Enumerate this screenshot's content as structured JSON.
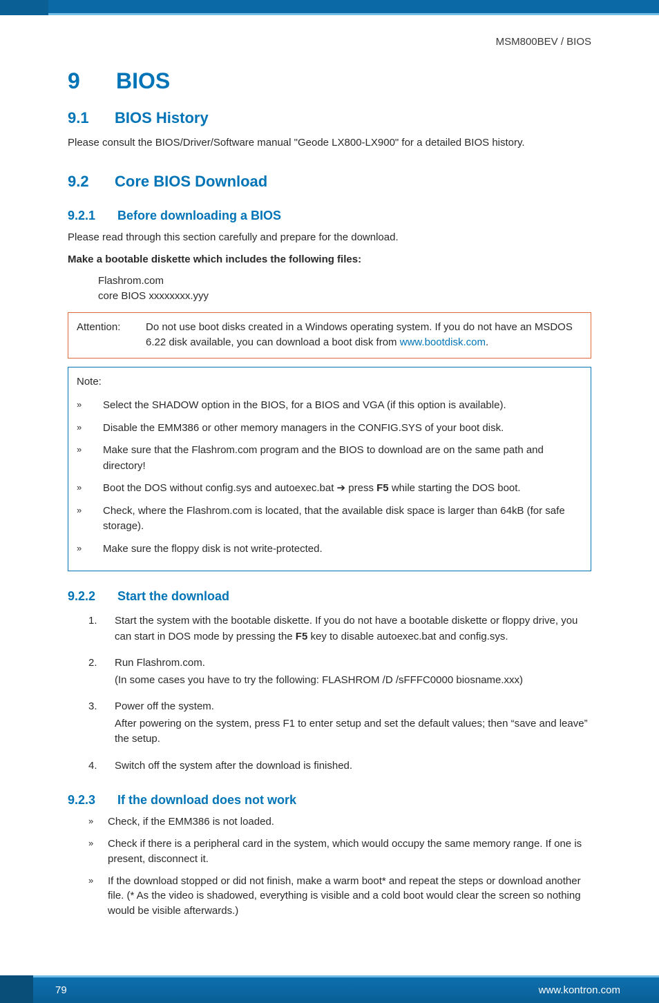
{
  "runhead": "MSM800BEV / BIOS",
  "h1": {
    "num": "9",
    "title": "BIOS"
  },
  "s1": {
    "num": "9.1",
    "title": "BIOS History",
    "p1": "Please consult the BIOS/Driver/Software manual \"Geode LX800-LX900\" for a detailed BIOS history."
  },
  "s2": {
    "num": "9.2",
    "title": "Core BIOS Download",
    "sub1": {
      "num": "9.2.1",
      "title": "Before downloading a BIOS",
      "p1": "Please read through this section carefully and prepare for the download.",
      "p2": "Make a bootable diskette which includes the following files:",
      "file1": "Flashrom.com",
      "file2": "core BIOS  xxxxxxxx.yyy",
      "attention": {
        "label": "Attention:",
        "text_pre": "Do not use boot disks created in a Windows operating system. If you do not have an MSDOS 6.22 disk available, you can download a boot disk from ",
        "link": "www.bootdisk.com",
        "text_post": "."
      },
      "note": {
        "title": "Note:",
        "items": [
          "Select the SHADOW option in the BIOS, for a BIOS and VGA (if this option is available).",
          "Disable the EMM386 or other memory managers in the CONFIG.SYS of your boot disk.",
          "Make sure that the Flashrom.com program and the BIOS to download are on the same path and directory!",
          {
            "pre": "Boot the DOS without config.sys and autoexec.bat ",
            "arrow": "➔",
            "mid": " press ",
            "bold": "F5",
            "post": " while starting the DOS boot."
          },
          "Check, where the Flashrom.com is located, that the available disk space is larger than 64kB (for safe storage).",
          "Make sure the floppy disk is not write-protected."
        ]
      }
    },
    "sub2": {
      "num": "9.2.2",
      "title": "Start the download",
      "items": [
        {
          "n": "1.",
          "lines": [
            {
              "pre": "Start the system with the bootable diskette. If you do not have a bootable diskette or floppy drive, you can start in DOS mode by pressing the ",
              "bold": "F5",
              "post": " key to disable autoexec.bat and config.sys."
            }
          ]
        },
        {
          "n": "2.",
          "lines": [
            "Run Flashrom.com.",
            "(In some cases you have to try the following:  FLASHROM /D /sFFFC0000 biosname.xxx)"
          ]
        },
        {
          "n": "3.",
          "lines": [
            "Power off the system.",
            "After powering on the system, press F1 to enter setup and set the default values; then “save and leave” the setup."
          ]
        },
        {
          "n": "4.",
          "lines": [
            "Switch off the system after the download is finished."
          ]
        }
      ]
    },
    "sub3": {
      "num": "9.2.3",
      "title": "If the download does not work",
      "items": [
        "Check, if the EMM386 is not loaded.",
        "Check if there is a peripheral card in the system, which would occupy the same memory range. If one is present, disconnect it.",
        "If the download stopped or did not finish, make a warm boot* and repeat the steps or download another file. (* As the video is shadowed, everything is visible and a cold boot would clear the screen so nothing would be visible afterwards.)"
      ]
    }
  },
  "footer": {
    "page": "79",
    "url": "www.kontron.com"
  },
  "glyph": {
    "chevron": "»"
  }
}
